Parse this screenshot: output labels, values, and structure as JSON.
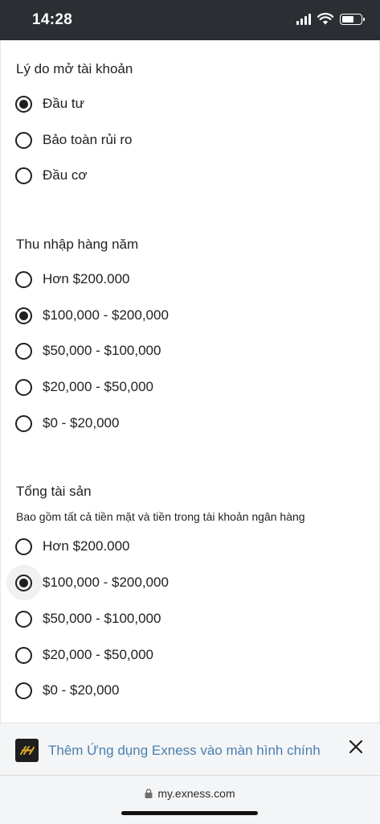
{
  "status": {
    "time": "14:28"
  },
  "sections": [
    {
      "title": "Lý do mở tài khoản",
      "description": "",
      "options": [
        {
          "label": "Đầu tư",
          "checked": true
        },
        {
          "label": "Bảo toàn rủi ro",
          "checked": false
        },
        {
          "label": "Đầu cơ",
          "checked": false
        }
      ]
    },
    {
      "title": "Thu nhập hàng năm",
      "description": "",
      "options": [
        {
          "label": "Hơn $200.000",
          "checked": false
        },
        {
          "label": "$100,000 - $200,000",
          "checked": true
        },
        {
          "label": "$50,000 - $100,000",
          "checked": false
        },
        {
          "label": "$20,000 - $50,000",
          "checked": false
        },
        {
          "label": "$0 - $20,000",
          "checked": false
        }
      ]
    },
    {
      "title": "Tổng tài sản",
      "description": "Bao gồm tất cả tiền mặt và tiền trong tài khoản ngân hàng",
      "options": [
        {
          "label": "Hơn $200.000",
          "checked": false
        },
        {
          "label": "$100,000 - $200,000",
          "checked": true
        },
        {
          "label": "$50,000 - $100,000",
          "checked": false
        },
        {
          "label": "$20,000 - $50,000",
          "checked": false
        },
        {
          "label": "$0 - $20,000",
          "checked": false
        }
      ]
    }
  ],
  "banner": {
    "text": "Thêm Ứng dụng Exness vào màn hình chính",
    "logo_icon": "exness-logo-icon",
    "close_icon": "close-icon"
  },
  "browser": {
    "url": "my.exness.com",
    "lock_icon": "lock-icon"
  },
  "colors": {
    "status_bar": "#2b2f33",
    "banner_text": "#4a7fb0",
    "radio": "#1f1f1f",
    "logo_mark": "#e0a82e"
  }
}
